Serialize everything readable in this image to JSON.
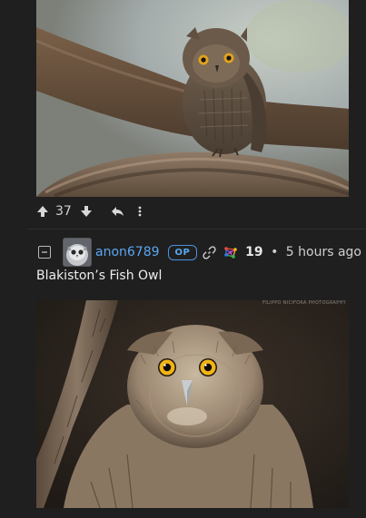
{
  "post": {
    "score": "37",
    "icons": [
      "upvote-icon",
      "downvote-icon",
      "reply-icon",
      "more-icon"
    ]
  },
  "comment": {
    "username": "anon6789",
    "op_badge": "OP",
    "score": "19",
    "separator": "•",
    "time_ago": "5 hours ago",
    "text": "Blakiston’s Fish Owl",
    "image_watermark": "FILIPPO NICIFORA PHOTOGRAPHY"
  },
  "colors": {
    "background": "#1f1f1f",
    "username": "#5aa7f0",
    "op_badge": "#5aa7f0"
  }
}
